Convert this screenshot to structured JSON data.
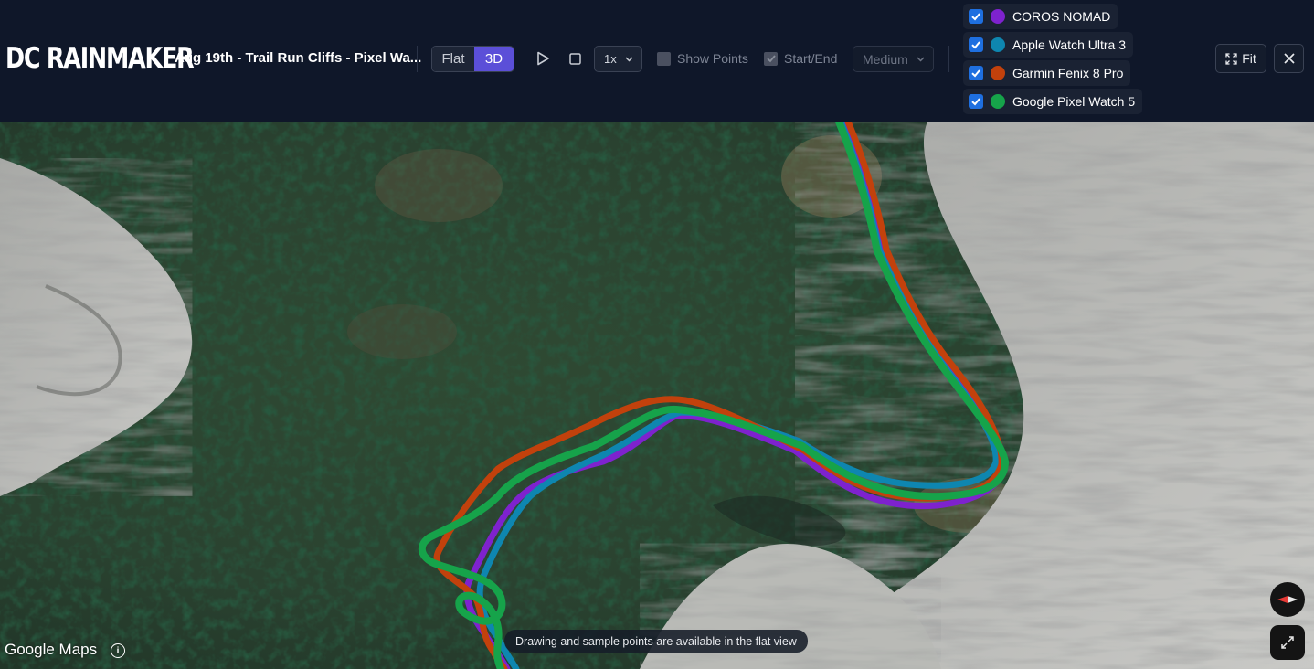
{
  "header": {
    "logo": "DC RAINMAKER",
    "activity_title": "Aug 19th - Trail Run Cliffs - Pixel Wa...",
    "view_modes": [
      {
        "label": "Flat",
        "active": false
      },
      {
        "label": "3D",
        "active": true
      }
    ],
    "speed_select": {
      "value": "1x"
    },
    "show_points": {
      "label": "Show Points",
      "checked": false
    },
    "start_end": {
      "label": "Start/End",
      "checked": true
    },
    "quality_select": {
      "value": "Medium"
    },
    "fit_label": "Fit"
  },
  "legend": {
    "devices": [
      {
        "name": "COROS NOMAD",
        "color": "#7e22ce",
        "checked": true
      },
      {
        "name": "Apple Watch Ultra 3",
        "color": "#0e86b0",
        "checked": true
      },
      {
        "name": "Garmin Fenix 8 Pro",
        "color": "#c2410c",
        "checked": true
      },
      {
        "name": "Google Pixel Watch 5",
        "color": "#16a34a",
        "checked": true
      }
    ]
  },
  "map": {
    "attribution": "Google Maps",
    "notice": "Drawing and sample points are available in the flat view"
  }
}
